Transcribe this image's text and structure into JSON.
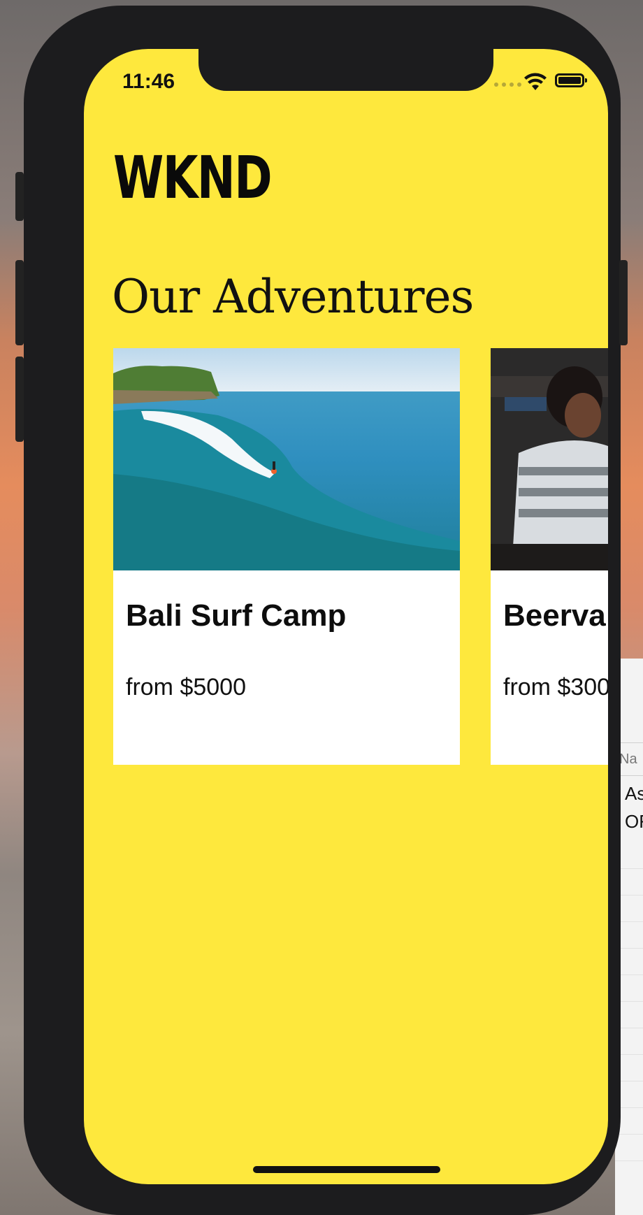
{
  "status_bar": {
    "time": "11:46"
  },
  "app": {
    "logo": "WKND"
  },
  "main": {
    "title": "Our Adventures",
    "cards": [
      {
        "title": "Bali Surf Camp",
        "price": "from $5000"
      },
      {
        "title": "Beerva",
        "price": "from $300"
      }
    ]
  },
  "background_window": {
    "header": "Na",
    "cells": [
      "As",
      "OF"
    ]
  },
  "colors": {
    "screen_background": "#fee83d",
    "card_background": "#ffffff",
    "text": "#111111"
  }
}
